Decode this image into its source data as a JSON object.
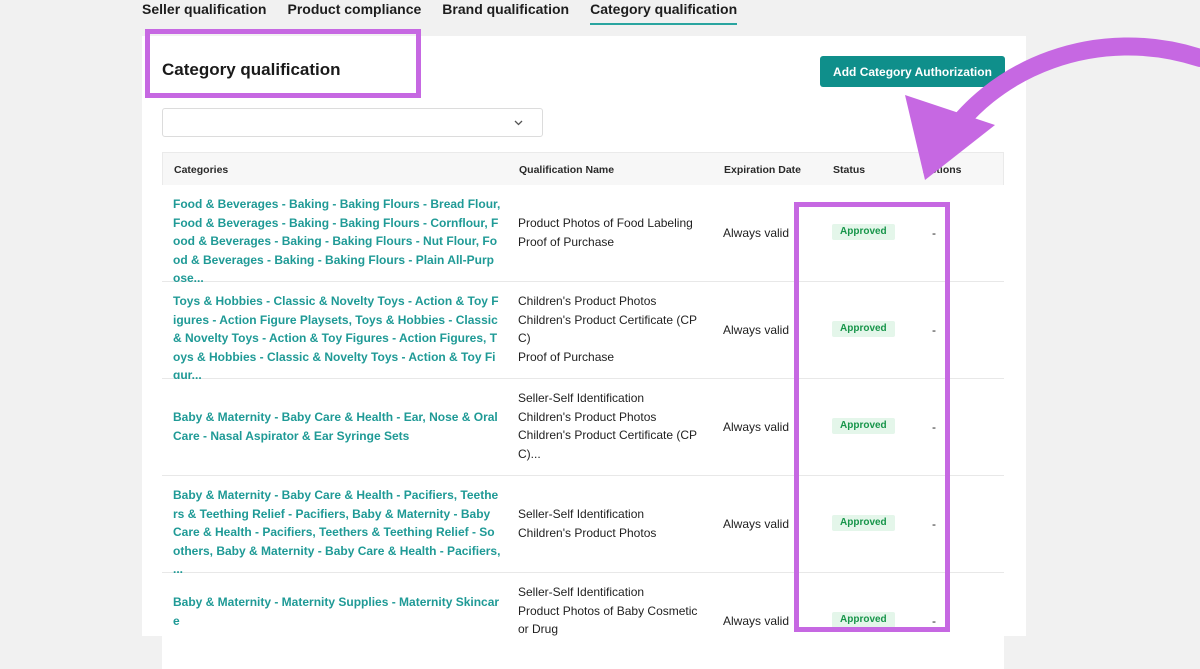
{
  "tabs": [
    {
      "label": "Seller qualification"
    },
    {
      "label": "Product compliance"
    },
    {
      "label": "Brand qualification"
    },
    {
      "label": "Category qualification"
    }
  ],
  "page": {
    "title": "Category qualification",
    "add_button": "Add Category Authorization",
    "select_value": ""
  },
  "table": {
    "headers": {
      "categories": "Categories",
      "qualification_name": "Qualification Name",
      "expiration_date": "Expiration Date",
      "status": "Status",
      "actions": "Actions"
    },
    "rows": [
      {
        "categories": "Food & Beverages - Baking - Baking Flours - Bread Flour, Food & Beverages - Baking - Baking Flours - Cornflour, Food & Beverages - Baking - Baking Flours - Nut Flour, Food & Beverages - Baking - Baking Flours - Plain All-Purpose...",
        "qualifications": [
          "Product Photos of Food Labeling",
          "Proof of Purchase"
        ],
        "expiration": "Always valid",
        "status": "Approved",
        "actions": "-"
      },
      {
        "categories": "Toys & Hobbies - Classic & Novelty Toys - Action & Toy Figures - Action Figure Playsets, Toys & Hobbies - Classic & Novelty Toys - Action & Toy Figures - Action Figures, Toys & Hobbies - Classic & Novelty Toys - Action & Toy Figur...",
        "qualifications": [
          "Children's Product Photos",
          "Children's Product Certificate (CPC)",
          "Proof of Purchase"
        ],
        "expiration": "Always valid",
        "status": "Approved",
        "actions": "-"
      },
      {
        "categories": "Baby & Maternity - Baby Care & Health - Ear, Nose & Oral Care - Nasal Aspirator & Ear Syringe Sets",
        "qualifications": [
          "Seller-Self Identification",
          "Children's Product Photos",
          "Children's Product Certificate (CPC)..."
        ],
        "expiration": "Always valid",
        "status": "Approved",
        "actions": "-"
      },
      {
        "categories": "Baby & Maternity - Baby Care & Health - Pacifiers, Teethers & Teething Relief - Pacifiers, Baby & Maternity - Baby Care & Health - Pacifiers, Teethers & Teething Relief - Soothers, Baby & Maternity - Baby Care & Health - Pacifiers, ...",
        "qualifications": [
          "Seller-Self Identification",
          "Children's Product Photos"
        ],
        "expiration": "Always valid",
        "status": "Approved",
        "actions": "-"
      },
      {
        "categories": "Baby & Maternity - Maternity Supplies - Maternity Skincare",
        "qualifications": [
          "Seller-Self Identification",
          "Product Photos of Baby Cosmetic or Drug"
        ],
        "expiration": "Always valid",
        "status": "Approved",
        "actions": "-"
      }
    ]
  },
  "icons": {
    "dropdown": "chevron-down-icon",
    "annotation": "curved-arrow-icon"
  },
  "colors": {
    "accent": "#1f9a96",
    "button": "#0f8f8b",
    "status_text": "#17954a",
    "status_bg": "#e4f6ea",
    "annotation": "#c668e2"
  }
}
